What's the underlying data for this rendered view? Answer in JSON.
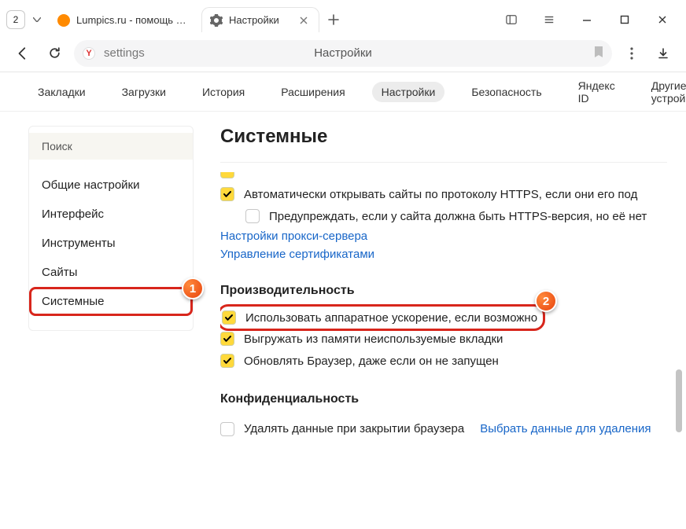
{
  "chrome": {
    "tab_count": "2",
    "tabs": [
      {
        "label": "Lumpics.ru - помощь с ко"
      },
      {
        "label": "Настройки"
      }
    ]
  },
  "addressbar": {
    "url_text": "settings",
    "page_title": "Настройки"
  },
  "topnav": {
    "items": [
      "Закладки",
      "Загрузки",
      "История",
      "Расширения",
      "Настройки",
      "Безопасность",
      "Яндекс ID",
      "Другие устройства"
    ],
    "active_index": 4
  },
  "sidebar": {
    "search_label": "Поиск",
    "items": [
      "Общие настройки",
      "Интерфейс",
      "Инструменты",
      "Сайты",
      "Системные"
    ],
    "selected_index": 4
  },
  "content": {
    "heading": "Системные",
    "network": {
      "auto_https": "Автоматически открывать сайты по протоколу HTTPS, если они его под",
      "warn_https": "Предупреждать, если у сайта должна быть HTTPS-версия, но её нет",
      "proxy_link": "Настройки прокси-сервера",
      "cert_link": "Управление сертификатами"
    },
    "performance": {
      "title": "Производительность",
      "hw_accel": "Использовать аппаратное ускорение, если возможно",
      "unload_tabs": "Выгружать из памяти неиспользуемые вкладки",
      "bg_update": "Обновлять Браузер, даже если он не запущен"
    },
    "privacy": {
      "title": "Конфиденциальность",
      "clear_on_close": "Удалять данные при закрытии браузера",
      "choose_data_link": "Выбрать данные для удаления"
    }
  },
  "annotations": {
    "badge1": "1",
    "badge2": "2"
  }
}
